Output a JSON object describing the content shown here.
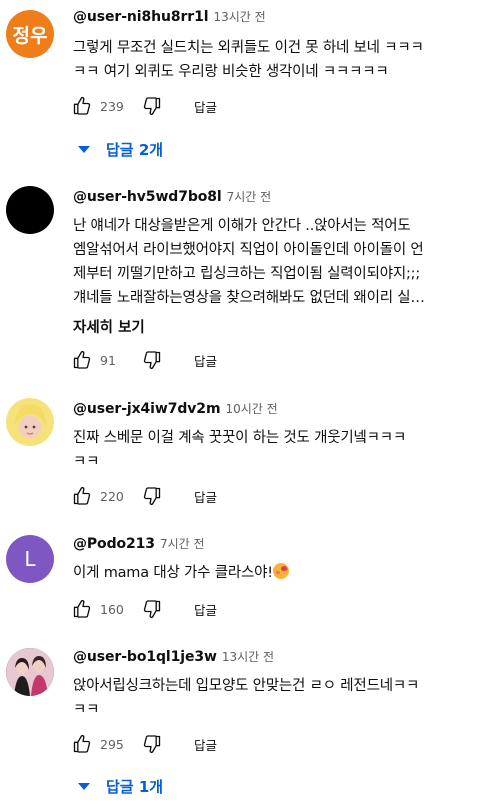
{
  "comments": [
    {
      "avatar_text": "정우",
      "avatar_color": "#ef7d1a",
      "handle": "@user-ni8hu8rr1l",
      "time": "13시간 전",
      "lines": [
        "그렇게 무조건 실드치는 외퀴들도 이건 못 하네 보네 ㅋㅋㅋ",
        "ㅋㅋ 여기 외퀴도 우리랑 비슷한 생각이네 ㅋㅋㅋㅋㅋ"
      ],
      "likes": "239",
      "reply_label": "답글",
      "replies_label": "답글 2개"
    },
    {
      "avatar_text": "",
      "avatar_color": "#000000",
      "handle": "@user-hv5wd7bo8l",
      "time": "7시간 전",
      "lines": [
        "난 얘네가 대상을받은게 이해가 안간다 ..앉아서는 적어도",
        "엠알섞어서 라이브했어야지 직업이 아이돌인데 아이돌이 언",
        "제부터 끼떨기만하고 립싱크하는 직업이됨 실력이되야지;;;",
        "걔네들 노래잘하는영상을 찾으려해봐도 없던데 왜이리 실…"
      ],
      "more_label": "자세히 보기",
      "likes": "91",
      "reply_label": "답글"
    },
    {
      "avatar_text": "",
      "avatar_color": "#e9d27a",
      "handle": "@user-jx4iw7dv2m",
      "time": "10시간 전",
      "lines": [
        "진짜 스베문 이걸 계속 꿋꿋이 하는 것도 개웃기넼ㅋㅋㅋ",
        "ㅋㅋ"
      ],
      "likes": "220",
      "reply_label": "답글"
    },
    {
      "avatar_text": "L",
      "avatar_color": "#7e57c2",
      "handle": "@Podo213",
      "time": "7시간 전",
      "lines": [
        "이게 mama 대상 가수 클라스야!"
      ],
      "emoji": "smiling-face-with-hearts",
      "likes": "160",
      "reply_label": "답글"
    },
    {
      "avatar_text": "",
      "avatar_color": "#d9d9d9",
      "handle": "@user-bo1ql1je3w",
      "time": "13시간 전",
      "lines": [
        "앉아서립싱크하는데 입모양도 안맞는건 ㄹㅇ 레전드네ㅋㅋ",
        "ㅋㅋ"
      ],
      "likes": "295",
      "reply_label": "답글",
      "replies_label": "답글 1개"
    }
  ],
  "colors": {
    "link_blue": "#065fd4",
    "meta_gray": "#606060"
  },
  "icons": [
    "thumb-up-icon",
    "thumb-down-icon",
    "chevron-down-icon"
  ]
}
